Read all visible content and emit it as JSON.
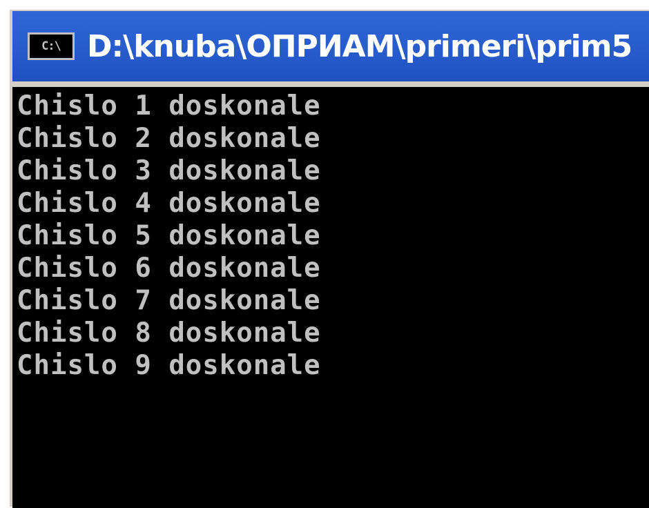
{
  "window": {
    "icon_text": "C:\\",
    "title": "D:\\knuba\\ОПРИАМ\\primeri\\prim5"
  },
  "console": {
    "lines": [
      "Chislo 1 doskonale",
      "Chislo 2 doskonale",
      "Chislo 3 doskonale",
      "Chislo 4 doskonale",
      "Chislo 5 doskonale",
      "Chislo 6 doskonale",
      "Chislo 7 doskonale",
      "Chislo 8 doskonale",
      "Chislo 9 doskonale"
    ]
  },
  "colors": {
    "titlebar": "#2a5fcf",
    "console_bg": "#000000",
    "console_text": "#c0c0c0"
  }
}
